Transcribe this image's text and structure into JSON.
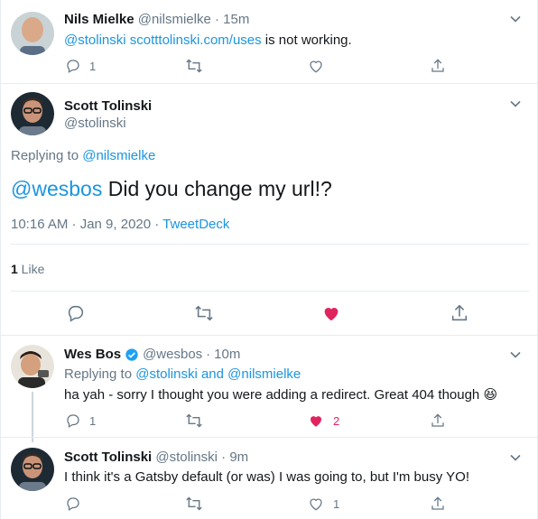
{
  "tweet1": {
    "name": "Nils Mielke",
    "handle": "@nilsmielke",
    "sep": "·",
    "time": "15m",
    "mention": "@stolinski",
    "url": "scotttolinski.com/uses",
    "text_rest": " is not working.",
    "reply_count": "1"
  },
  "main": {
    "name": "Scott Tolinski",
    "handle": "@stolinski",
    "replying_prefix": "Replying to ",
    "replying_to": "@nilsmielke",
    "mention": "@wesbos",
    "text": " Did you change my url!?",
    "timestamp": "10:16 AM · Jan 9, 2020 · ",
    "source": "TweetDeck",
    "like_count": "1",
    "like_label": " Like"
  },
  "tweet3": {
    "name": "Wes Bos",
    "handle": "@wesbos",
    "sep": "·",
    "time": "10m",
    "replying_prefix": "Replying to ",
    "replying_to_1": "@stolinski",
    "replying_and": " and ",
    "replying_to_2": "@nilsmielke",
    "text": "ha yah - sorry I thought you were adding a redirect. Great 404 though ",
    "emoji": "😆",
    "reply_count": "1",
    "like_count": "2"
  },
  "tweet4": {
    "name": "Scott Tolinski",
    "handle": "@stolinski",
    "sep": "·",
    "time": "9m",
    "text": "I think it's a Gatsby default (or was) I was going to, but I'm busy YO!",
    "like_count": "1"
  },
  "colors": {
    "link": "#1b95e0",
    "like_active": "#e0245e",
    "icon": "#657786"
  }
}
